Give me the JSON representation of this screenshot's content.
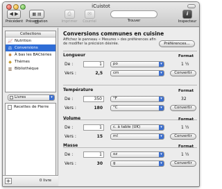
{
  "window": {
    "title": "iCuistot"
  },
  "toolbar": {
    "previous": "Précédent",
    "presentation": "Présentation",
    "print": "Imprimer",
    "mail": "Courriel",
    "search_label": "Trouver",
    "search_value": "",
    "inspector": "Inspecteur",
    "inspector_icon": "i"
  },
  "sidebar": {
    "collections_header": "Collections",
    "collections": [
      {
        "label": "Nutrition",
        "icon": "chart-icon"
      },
      {
        "label": "Conversions",
        "icon": "scale-icon",
        "selected": true
      },
      {
        "label": "À bas les BACtéries",
        "icon": "bacteria-icon"
      },
      {
        "label": "Thèmes",
        "icon": "theme-icon"
      },
      {
        "label": "Bibliothèque",
        "icon": "library-icon"
      }
    ],
    "books_selector": "Livres",
    "books": [
      "Recettes de Pierre"
    ],
    "add_button": "+",
    "book_count": "0 livre"
  },
  "main": {
    "title": "Conversions communes en cuisine",
    "description": "Affichez le panneau « Mesures » des préférences afin de modifier la précision désirée.",
    "preferences_button": "Préférences...",
    "format_header": "Format",
    "convert_label": "Convertir",
    "from_label": "De :",
    "to_label": "Vers :",
    "sections": [
      {
        "title": "Longueur",
        "from_value": "1",
        "from_unit": "po",
        "from_format": "1 ½",
        "to_value": "2,5",
        "to_unit": "cm"
      },
      {
        "title": "Température",
        "from_value": "350",
        "from_unit": "°F",
        "from_format": "32",
        "to_value": "180",
        "to_unit": "°C"
      },
      {
        "title": "Volume",
        "from_value": "1",
        "from_unit": "c. à table (UK)",
        "from_format": "1 ½",
        "to_value": "15",
        "to_unit": "ml"
      },
      {
        "title": "Masse",
        "from_value": "1",
        "from_unit": "oz",
        "from_format": "1 ½",
        "to_value": "30",
        "to_unit": "g"
      }
    ]
  },
  "colors": {
    "selection": "#2f6dd6",
    "popup_arrow": "#3b6fd0"
  }
}
